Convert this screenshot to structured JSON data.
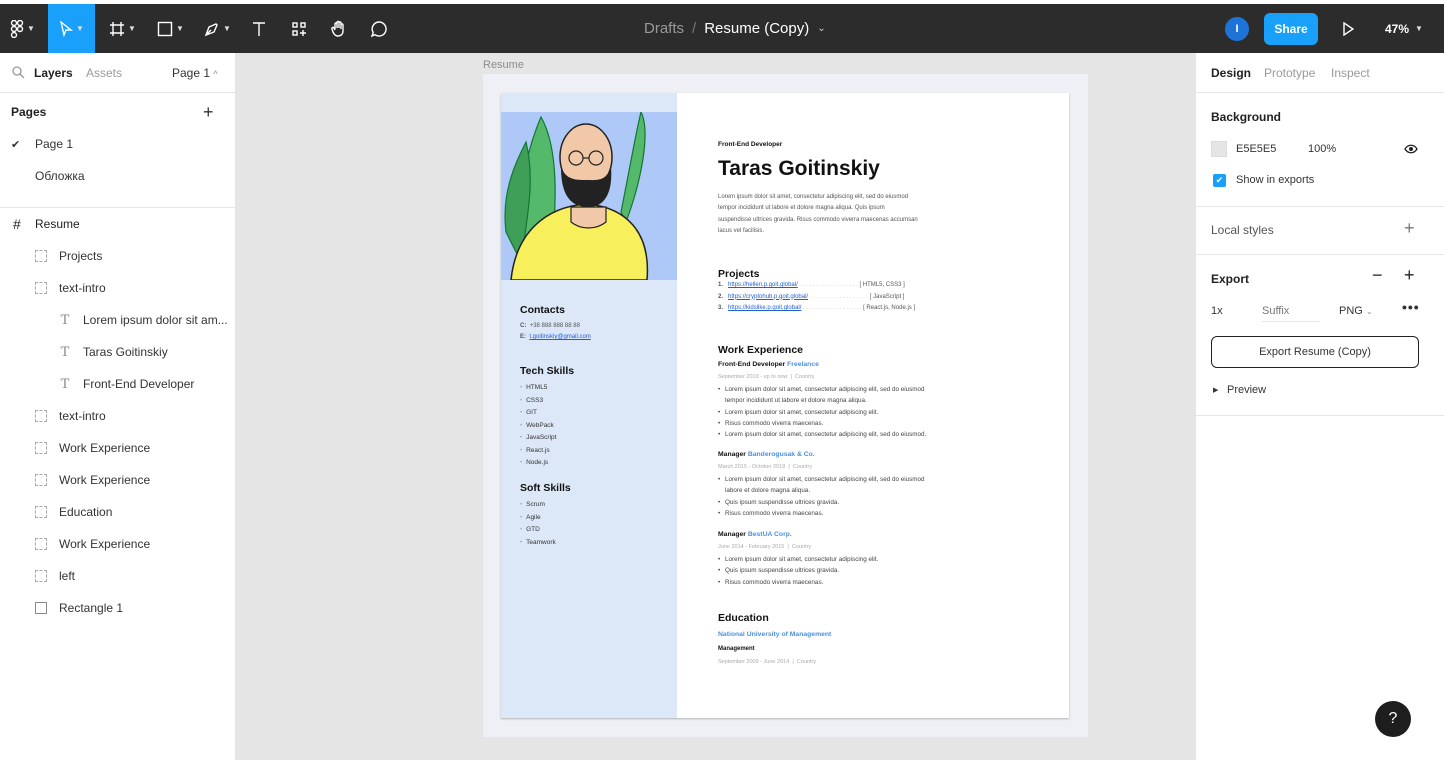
{
  "toolbar": {
    "breadcrumb_parent": "Drafts",
    "breadcrumb_sep": "/",
    "file_name": "Resume (Copy)",
    "user_initial": "I",
    "share_label": "Share",
    "zoom": "47%",
    "chevron": "⌄"
  },
  "left_panel": {
    "tabs": [
      "Layers",
      "Assets"
    ],
    "page_selector": "Page 1",
    "pages_heading": "Pages",
    "pages": [
      {
        "label": "Page 1",
        "active": true
      },
      {
        "label": "Обложка",
        "active": false
      }
    ],
    "root_frame": "Resume",
    "layers": [
      {
        "label": "Projects",
        "type": "group"
      },
      {
        "label": "text-intro",
        "type": "group"
      },
      {
        "label": "Lorem ipsum dolor sit am...",
        "type": "text"
      },
      {
        "label": "Taras Goitinskiy",
        "type": "text"
      },
      {
        "label": "Front-End Developer",
        "type": "text"
      },
      {
        "label": "text-intro",
        "type": "group"
      },
      {
        "label": "Work Experience",
        "type": "group"
      },
      {
        "label": "Work Experience",
        "type": "group"
      },
      {
        "label": "Education",
        "type": "group"
      },
      {
        "label": "Work Experience",
        "type": "group"
      },
      {
        "label": "left",
        "type": "group"
      },
      {
        "label": "Rectangle 1",
        "type": "rect"
      }
    ]
  },
  "canvas": {
    "frame_label": "Resume",
    "resume": {
      "role": "Front-End Developer",
      "name": "Taras Goitinskiy",
      "intro_1": "Lorem ipsum dolor sit amet, consectetur adipiscing elit, sed do eiusmod",
      "intro_2": "tempor incididunt ut labore et dolore magna aliqua. Quis ipsum",
      "intro_3": "suspendisse ultrices gravida. Risus commodo viverra maecenas accumsan",
      "intro_4": "lacus vel facilisis.",
      "contacts_heading": "Contacts",
      "phone_label": "C:",
      "phone": "+38 888 888 88 88",
      "email_label": "E:",
      "email": "t.goitinskiy@gmail.com",
      "tech_heading": "Tech Skills",
      "tech_skills": [
        "HTML5",
        "CSS3",
        "GIT",
        "WebPack",
        "JavaScript",
        "React.js",
        "Node.js"
      ],
      "soft_heading": "Soft Skills",
      "soft_skills": [
        "Scrum",
        "Agile",
        "GTD",
        "Teamwork"
      ],
      "projects_heading": "Projects",
      "projects": [
        {
          "n": "1.",
          "url": "https://hellen.p.goit.global/",
          "tags": "[ HTML5, CSS3 ]"
        },
        {
          "n": "2.",
          "url": "https://cryptohub.p.goit.global/",
          "tags": "[ JavaScript ]"
        },
        {
          "n": "3.",
          "url": "https://kidslike.p.goit.global/",
          "tags": "[ React.js, Node.js ]"
        }
      ],
      "work_heading": "Work Experience",
      "jobs": [
        {
          "title": "Front-End Developer",
          "company": "Freelance",
          "dates": "September 2019 - up to now",
          "location": "Country",
          "bullets": [
            "Lorem ipsum dolor sit amet, consectetur adipiscing elit, sed do eiusmod",
            "tempor incididunt ut labore et dolore magna aliqua.",
            "Lorem ipsum dolor sit amet, consectetur adipiscing elit.",
            "Risus commodo viverra maecenas.",
            "Lorem ipsum dolor sit amet, consectetur adipiscing elit, sed do eiusmod."
          ]
        },
        {
          "title": "Manager",
          "company": "Banderogusak & Co.",
          "dates": "March 2015 - October 2018",
          "location": "Country",
          "bullets": [
            "Lorem ipsum dolor sit amet, consectetur adipiscing elit, sed do eiusmod",
            "labore et dolore magna aliqua.",
            "Quis ipsum suspendisse ultrices gravida.",
            "Risus commodo viverra maecenas."
          ]
        },
        {
          "title": "Manager",
          "company": "BestUA Corp.",
          "dates": "June 2014 - February 2015",
          "location": "Country",
          "bullets": [
            "Lorem ipsum dolor sit amet, consectetur adipiscing elit.",
            "Quis ipsum suspendisse ultrices gravida.",
            "Risus commodo viverra maecenas."
          ]
        }
      ],
      "education_heading": "Education",
      "school": "National University of Management",
      "degree": "Management",
      "edu_dates": "September 2009 - June 2014",
      "edu_location": "Country",
      "date_sep": "|"
    }
  },
  "right_panel": {
    "tabs": [
      "Design",
      "Prototype",
      "Inspect"
    ],
    "background_heading": "Background",
    "bg_hex": "E5E5E5",
    "bg_opacity": "100%",
    "show_in_exports": "Show in exports",
    "local_styles": "Local styles",
    "export_heading": "Export",
    "export_scale": "1x",
    "suffix_placeholder": "Suffix",
    "format": "PNG",
    "export_button": "Export Resume (Copy)",
    "preview": "Preview"
  },
  "help_label": "?",
  "colors": {
    "accent": "#18a0fb",
    "toolbar": "#2c2c2c",
    "canvas": "#e5e5e5"
  }
}
